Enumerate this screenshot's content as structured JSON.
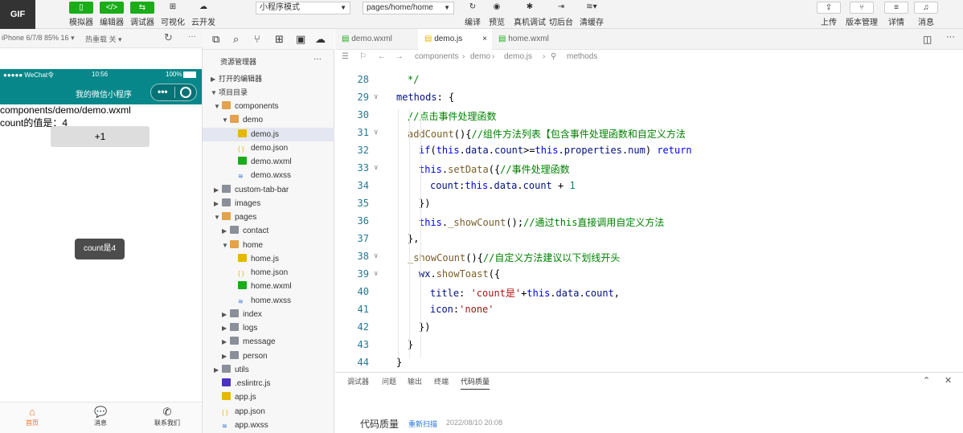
{
  "toolbar": {
    "buttons": [
      {
        "label": "模拟器",
        "icon": "phone-icon"
      },
      {
        "label": "编辑器",
        "icon": "code-icon"
      },
      {
        "label": "调试器",
        "icon": "debug-icon"
      },
      {
        "label": "可视化",
        "icon": "grid-icon"
      },
      {
        "label": "云开发",
        "icon": "cloud-icon"
      }
    ],
    "mode_select": "小程序模式",
    "page_select": "pages/home/home",
    "actions": [
      {
        "label": "编译",
        "icon": "refresh-icon"
      },
      {
        "label": "预览",
        "icon": "eye-icon"
      },
      {
        "label": "真机调试",
        "icon": "bug-icon"
      },
      {
        "label": "切后台",
        "icon": "switch-icon"
      },
      {
        "label": "清缓存",
        "icon": "layers-icon"
      }
    ],
    "right_actions": [
      {
        "label": "上传",
        "icon": "upload-icon"
      },
      {
        "label": "版本管理",
        "icon": "branch-icon"
      },
      {
        "label": "详情",
        "icon": "menu-icon"
      },
      {
        "label": "消息",
        "icon": "bell-icon"
      }
    ],
    "gif_badge": "GIF"
  },
  "simulator": {
    "device": "iPhone 6/7/8 85% 16 ▾",
    "hot_reload": "热重载 关 ▾",
    "status_left": "●●●●● WeChat令",
    "status_time": "10:56",
    "status_battery": "100%",
    "nav_title": "我的微信小程序",
    "line1": "components/demo/demo.wxml",
    "line2": "count的值是：4",
    "plus_button": "+1",
    "toast": "count是4",
    "tabs": [
      {
        "label": "首页",
        "icon": "home-icon",
        "active": true
      },
      {
        "label": "消息",
        "icon": "chat-icon",
        "active": false
      },
      {
        "label": "联系我们",
        "icon": "phone-call-icon",
        "active": false
      }
    ]
  },
  "explorer": {
    "title": "资源管理器",
    "more": "···",
    "open_editors": "打开的编辑器",
    "project": "项目目录",
    "items": [
      {
        "label": "components",
        "kind": "folder-open",
        "depth": 1
      },
      {
        "label": "demo",
        "kind": "folder-open",
        "depth": 2
      },
      {
        "label": "demo.js",
        "kind": "js",
        "depth": 3,
        "selected": true
      },
      {
        "label": "demo.json",
        "kind": "json",
        "depth": 3
      },
      {
        "label": "demo.wxml",
        "kind": "wxml",
        "depth": 3
      },
      {
        "label": "demo.wxss",
        "kind": "wxss",
        "depth": 3
      },
      {
        "label": "custom-tab-bar",
        "kind": "folder",
        "depth": 1
      },
      {
        "label": "images",
        "kind": "folder",
        "depth": 1
      },
      {
        "label": "pages",
        "kind": "folder-open",
        "depth": 1
      },
      {
        "label": "contact",
        "kind": "folder",
        "depth": 2
      },
      {
        "label": "home",
        "kind": "folder-open",
        "depth": 2
      },
      {
        "label": "home.js",
        "kind": "js",
        "depth": 3
      },
      {
        "label": "home.json",
        "kind": "json",
        "depth": 3
      },
      {
        "label": "home.wxml",
        "kind": "wxml",
        "depth": 3
      },
      {
        "label": "home.wxss",
        "kind": "wxss",
        "depth": 3
      },
      {
        "label": "index",
        "kind": "folder",
        "depth": 2
      },
      {
        "label": "logs",
        "kind": "folder",
        "depth": 2
      },
      {
        "label": "message",
        "kind": "folder",
        "depth": 2
      },
      {
        "label": "person",
        "kind": "folder",
        "depth": 2
      },
      {
        "label": "utils",
        "kind": "folder",
        "depth": 1
      },
      {
        "label": ".eslintrc.js",
        "kind": "eslint",
        "depth": 1
      },
      {
        "label": "app.js",
        "kind": "js",
        "depth": 1
      },
      {
        "label": "app.json",
        "kind": "json",
        "depth": 1
      },
      {
        "label": "app.wxss",
        "kind": "wxss",
        "depth": 1
      }
    ]
  },
  "editor": {
    "tabs": [
      {
        "label": "demo.wxml",
        "active": false
      },
      {
        "label": "demo.js",
        "active": true,
        "close": "×"
      },
      {
        "label": "home.wxml",
        "active": false
      }
    ],
    "breadcrumb": [
      "components",
      "demo",
      "demo.js",
      "methods"
    ],
    "lines": [
      {
        "n": "28",
        "indent": 1,
        "parts": [
          [
            "c",
            "*/"
          ]
        ]
      },
      {
        "n": "29",
        "indent": 0,
        "fold": true,
        "parts": [
          [
            "p",
            "methods"
          ],
          [
            "x",
            ": {"
          ]
        ]
      },
      {
        "n": "30",
        "indent": 1,
        "parts": [
          [
            "c",
            "//点击事件处理函数"
          ]
        ]
      },
      {
        "n": "31",
        "indent": 1,
        "fold": true,
        "parts": [
          [
            "f",
            "addCount"
          ],
          [
            "x",
            "(){"
          ],
          [
            "c",
            "//组件方法列表【包含事件处理函数和自定义方法"
          ]
        ]
      },
      {
        "n": "32",
        "indent": 2,
        "parts": [
          [
            "k",
            "if"
          ],
          [
            "x",
            "("
          ],
          [
            "k",
            "this"
          ],
          [
            "x",
            "."
          ],
          [
            "p",
            "data"
          ],
          [
            "x",
            "."
          ],
          [
            "p",
            "count"
          ],
          [
            "x",
            ">="
          ],
          [
            "k",
            "this"
          ],
          [
            "x",
            "."
          ],
          [
            "p",
            "properties"
          ],
          [
            "x",
            "."
          ],
          [
            "p",
            "num"
          ],
          [
            "x",
            ") "
          ],
          [
            "k",
            "return"
          ]
        ]
      },
      {
        "n": "33",
        "indent": 2,
        "fold": true,
        "parts": [
          [
            "k",
            "this"
          ],
          [
            "x",
            "."
          ],
          [
            "f",
            "setData"
          ],
          [
            "x",
            "({"
          ],
          [
            "c",
            "//事件处理函数"
          ]
        ]
      },
      {
        "n": "34",
        "indent": 3,
        "parts": [
          [
            "p",
            "count"
          ],
          [
            "x",
            ":"
          ],
          [
            "k",
            "this"
          ],
          [
            "x",
            "."
          ],
          [
            "p",
            "data"
          ],
          [
            "x",
            "."
          ],
          [
            "p",
            "count"
          ],
          [
            "x",
            " + "
          ],
          [
            "n",
            "1"
          ]
        ]
      },
      {
        "n": "35",
        "indent": 2,
        "parts": [
          [
            "x",
            "})"
          ]
        ]
      },
      {
        "n": "36",
        "indent": 2,
        "parts": [
          [
            "k",
            "this"
          ],
          [
            "x",
            "."
          ],
          [
            "f",
            "_showCount"
          ],
          [
            "x",
            "();"
          ],
          [
            "c",
            "//通过this直接调用自定义方法"
          ]
        ]
      },
      {
        "n": "37",
        "indent": 1,
        "parts": [
          [
            "x",
            "},"
          ]
        ]
      },
      {
        "n": "38",
        "indent": 1,
        "fold": true,
        "parts": [
          [
            "f",
            "_showCount"
          ],
          [
            "x",
            "(){"
          ],
          [
            "c",
            "//自定义方法建议以下划线开头"
          ]
        ]
      },
      {
        "n": "39",
        "indent": 2,
        "fold": true,
        "parts": [
          [
            "p",
            "wx"
          ],
          [
            "x",
            "."
          ],
          [
            "f",
            "showToast"
          ],
          [
            "x",
            "({"
          ]
        ]
      },
      {
        "n": "40",
        "indent": 3,
        "parts": [
          [
            "p",
            "title"
          ],
          [
            "x",
            ": "
          ],
          [
            "s",
            "'count是'"
          ],
          [
            "x",
            "+"
          ],
          [
            "k",
            "this"
          ],
          [
            "x",
            "."
          ],
          [
            "p",
            "data"
          ],
          [
            "x",
            "."
          ],
          [
            "p",
            "count"
          ],
          [
            "x",
            ","
          ]
        ]
      },
      {
        "n": "41",
        "indent": 3,
        "parts": [
          [
            "p",
            "icon"
          ],
          [
            "x",
            ":"
          ],
          [
            "s",
            "'none'"
          ]
        ]
      },
      {
        "n": "42",
        "indent": 2,
        "parts": [
          [
            "x",
            "})"
          ]
        ]
      },
      {
        "n": "43",
        "indent": 1,
        "parts": [
          [
            "x",
            "}"
          ]
        ]
      },
      {
        "n": "44",
        "indent": 0,
        "parts": [
          [
            "x",
            "}"
          ]
        ]
      }
    ]
  },
  "panel": {
    "tabs": [
      "调试器",
      "问题",
      "输出",
      "终端",
      "代码质量"
    ],
    "active_tab": "代码质量",
    "title": "代码质量",
    "rescan": "重新扫描",
    "timestamp": "2022/08/10 20:08"
  },
  "colors": {
    "accent_green": "#1aad19",
    "nav_teal": "#07878a",
    "tab_orange": "#f26b1d"
  }
}
